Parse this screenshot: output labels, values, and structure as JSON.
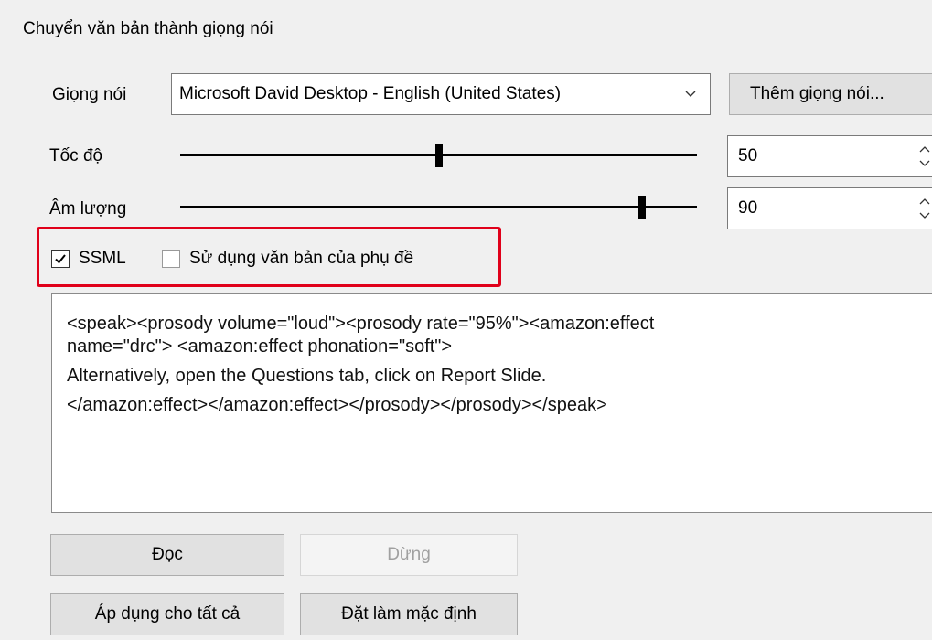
{
  "dialog": {
    "title": "Chuyển văn bản thành giọng nói"
  },
  "voice": {
    "label": "Giọng nói",
    "selected": "Microsoft David Desktop - English (United States)",
    "add_button": "Thêm giọng nói..."
  },
  "speed": {
    "label": "Tốc độ",
    "value": "50",
    "slider_fraction": 0.5
  },
  "volume": {
    "label": "Âm lượng",
    "value": "90",
    "slider_fraction": 0.9
  },
  "options": {
    "ssml_label": "SSML",
    "ssml_checked": true,
    "subtitle_text_label": "Sử dụng văn bản của phụ đề",
    "subtitle_text_checked": false
  },
  "text": {
    "lines": [
      "<speak><prosody volume=\"loud\"><prosody rate=\"95%\"><amazon:effect",
      "name=\"drc\"> <amazon:effect phonation=\"soft\">",
      "Alternatively, open the Questions tab, click on Report Slide.",
      "</amazon:effect></amazon:effect></prosody></prosody></speak>"
    ]
  },
  "buttons": {
    "read": "Đọc",
    "stop": "Dừng",
    "apply_all": "Áp dụng cho tất cả",
    "set_default": "Đặt làm mặc định"
  },
  "colors": {
    "highlight": "#e0001a"
  }
}
